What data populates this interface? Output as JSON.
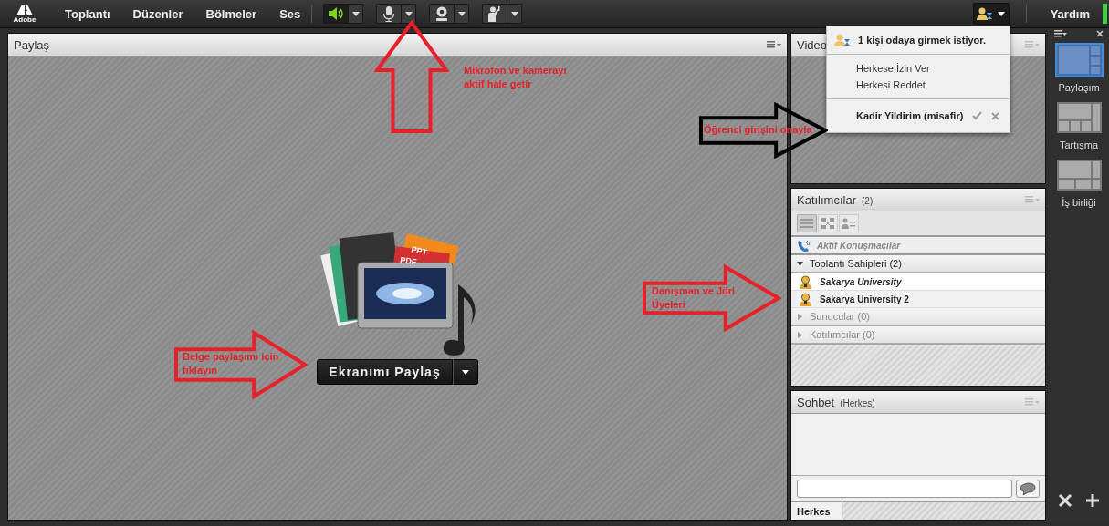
{
  "menubar": {
    "logo": "Adobe",
    "menus": [
      "Toplantı",
      "Düzenler",
      "Bölmeler",
      "Ses"
    ],
    "controls": [
      {
        "kind": "speaker",
        "on": true
      },
      {
        "kind": "mic",
        "on": false
      },
      {
        "kind": "camera",
        "on": false
      },
      {
        "kind": "hand",
        "on": false
      }
    ],
    "help": "Yardım"
  },
  "share_pod": {
    "title": "Paylaş",
    "file_labels": [
      "PPT",
      "PDF"
    ],
    "button": "Ekranımı Paylaş"
  },
  "video_pod": {
    "title": "Video"
  },
  "request_menu": {
    "header": "1 kişi odaya girmek istiyor.",
    "actions": [
      "Herkese İzin Ver",
      "Herkesi Reddet"
    ],
    "requests": [
      {
        "name": "Kadir Yildirim (misafir)"
      }
    ]
  },
  "attendees_pod": {
    "title": "Katılımcılar",
    "count": "(2)",
    "view_buttons": [
      {
        "kind": "list",
        "selected": true
      },
      {
        "kind": "grid",
        "selected": false
      },
      {
        "kind": "person",
        "selected": false
      }
    ],
    "active_speakers": "Aktif Konuşmacılar",
    "groups": [
      {
        "label": "Toplantı Sahipleri (2)",
        "expanded": true,
        "children": [
          {
            "name": "Sakarya University",
            "current_user": true
          },
          {
            "name": "Sakarya University 2",
            "current_user": false
          }
        ]
      },
      {
        "label": "Sunucular (0)",
        "expanded": false
      },
      {
        "label": "Katılımcılar (0)",
        "expanded": false
      }
    ]
  },
  "chat_pod": {
    "title": "Sohbet",
    "scope": "(Herkes)",
    "tab": "Herkes"
  },
  "layouts": [
    {
      "label": "Paylaşım",
      "kind": "share",
      "selected": true
    },
    {
      "label": "Tartışma",
      "kind": "discussion",
      "selected": false
    },
    {
      "label": "İş birliği",
      "kind": "collaboration",
      "selected": false
    }
  ],
  "annotations": [
    {
      "kind": "up",
      "color": "#e8202a",
      "lines": [
        "Mikrofon ve kamerayı",
        "aktif hale getir"
      ]
    },
    {
      "kind": "right",
      "color": "#000000",
      "lines": [
        "Öğrenci girişini onayla"
      ]
    },
    {
      "kind": "right",
      "color": "#e8202a",
      "lines": [
        "Danışman ve Jüri",
        "Üyeleri"
      ]
    },
    {
      "kind": "right",
      "color": "#e8202a",
      "lines": [
        "Belge paylaşımı için",
        "tıklayın"
      ]
    }
  ]
}
